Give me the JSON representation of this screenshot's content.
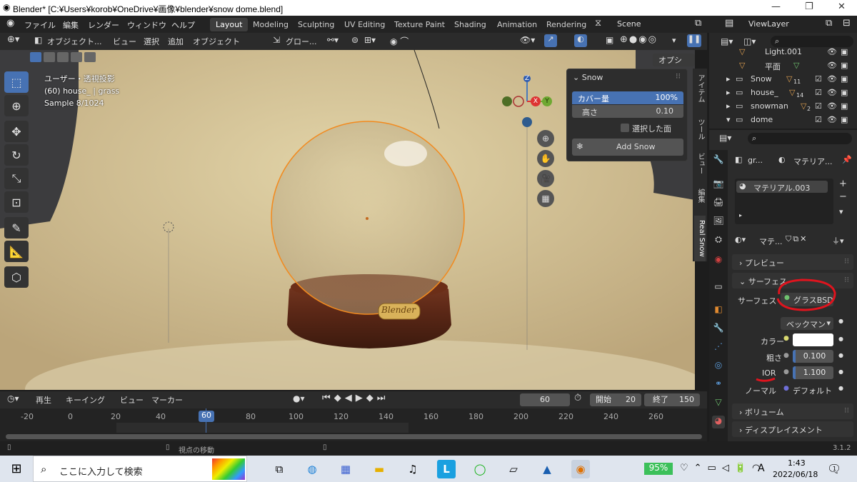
{
  "window": {
    "title": "Blender* [C:¥Users¥korob¥OneDrive¥画像¥blender¥snow dome.blend]",
    "minimize": "—",
    "maximize": "❐",
    "close": "✕"
  },
  "menu": {
    "file": "ファイル",
    "edit": "編集",
    "render": "レンダー",
    "window": "ウィンドウ",
    "help": "ヘルプ"
  },
  "workspaces": [
    "Layout",
    "Modeling",
    "Sculpting",
    "UV Editing",
    "Texture Paint",
    "Shading",
    "Animation",
    "Rendering"
  ],
  "scene": "Scene",
  "view_layer": "ViewLayer",
  "viewport_header": {
    "mode": "オブジェクト...",
    "view": "ビュー",
    "select": "選択",
    "add": "追加",
    "object": "オブジェクト",
    "transform": "グロー...",
    "options": "オプション"
  },
  "overlay": {
    "line1": "ユーザー・透視投影",
    "line2": "(60) house_ | grass",
    "line3": "Sample 8/1024",
    "plate": "Blender"
  },
  "gizmo": {
    "z": "Z",
    "x": "X",
    "y": "Y"
  },
  "snow_panel": {
    "title": "Snow",
    "cover_label": "カバー量",
    "cover_value": "100%",
    "height_label": "高さ",
    "height_value": "0.10",
    "selected_faces": "選択した面",
    "add_button": "Add Snow"
  },
  "side_tabs": [
    "アイテム",
    "ツール",
    "ビュー",
    "編集",
    "Real Snow"
  ],
  "timeline": {
    "playback": "再生",
    "keying": "キーイング",
    "view": "ビュー",
    "marker": "マーカー",
    "current": "60",
    "start_label": "開始",
    "start": "20",
    "end_label": "終了",
    "end": "150",
    "ticks": [
      "-20",
      "0",
      "20",
      "40",
      "60",
      "80",
      "100",
      "120",
      "140",
      "160",
      "180",
      "200",
      "220",
      "240",
      "260"
    ],
    "frame_indicator": "60"
  },
  "status": {
    "hint": "視点の移動",
    "version": "3.1.2"
  },
  "outliner": {
    "search_placeholder": "",
    "rows": [
      {
        "name": "Light.001",
        "icon": "light"
      },
      {
        "name": "平面",
        "icon": "mesh"
      },
      {
        "name": "Snow",
        "icon": "collection",
        "count": "11"
      },
      {
        "name": "house_",
        "icon": "collection",
        "count": "14"
      },
      {
        "name": "snowman",
        "icon": "collection",
        "count": "2"
      },
      {
        "name": "dome",
        "icon": "collection"
      }
    ]
  },
  "properties": {
    "breadcrumb_obj": "gr...",
    "breadcrumb_mat": "マテリア...",
    "slot": "マテリアル.003",
    "datablock": "マテ...",
    "preview": "プレビュー",
    "surface_section": "サーフェス",
    "surface_label": "サーフェス",
    "surface_value": "グラスBSD",
    "distribution": "ベックマン",
    "color_label": "カラー",
    "roughness_label": "粗さ",
    "roughness_value": "0.100",
    "ior_label": "IOR",
    "ior_value": "1.100",
    "normal_label": "ノーマル",
    "normal_value": "デフォルト",
    "volume": "ボリューム",
    "displacement": "ディスプレイスメント"
  },
  "taskbar": {
    "search_placeholder": "ここに入力して検索",
    "battery": "95%",
    "time": "1:43",
    "date": "2022/06/18",
    "ime": "A",
    "notif": "1"
  },
  "colors": {
    "accent": "#4772b3",
    "selection_orange": "#f28a1e",
    "annotation_red": "#e0141e"
  }
}
